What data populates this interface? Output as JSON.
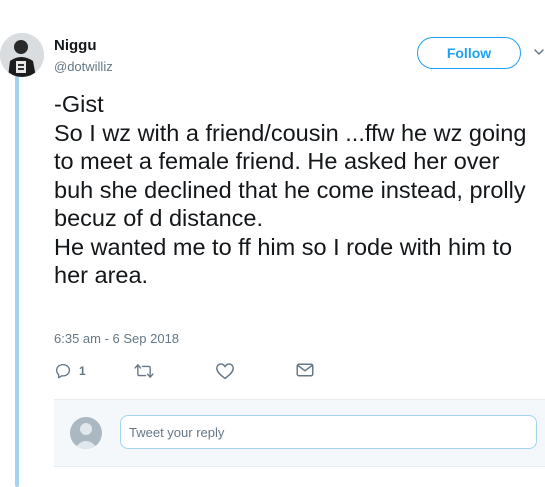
{
  "author": {
    "name": "Niggu",
    "handle": "@dotwilliz"
  },
  "follow_label": "Follow",
  "tweet": {
    "text": "-Gist\nSo I wz with a friend/cousin ...ffw he wz going to meet a female friend. He asked her over buh she declined that he come instead, prolly becuz of d distance.\nHe wanted me to ff him so I rode with him to her area.",
    "timestamp": "6:35 am - 6 Sep 2018"
  },
  "actions": {
    "reply_count": "1",
    "reply_icon": "reply-icon",
    "retweet_icon": "retweet-icon",
    "like_icon": "heart-icon",
    "dm_icon": "envelope-icon"
  },
  "reply_box": {
    "placeholder": "Tweet your reply"
  },
  "colors": {
    "accent": "#1da1f2",
    "thread_line": "#a3d4ef",
    "secondary_text": "#657786"
  }
}
